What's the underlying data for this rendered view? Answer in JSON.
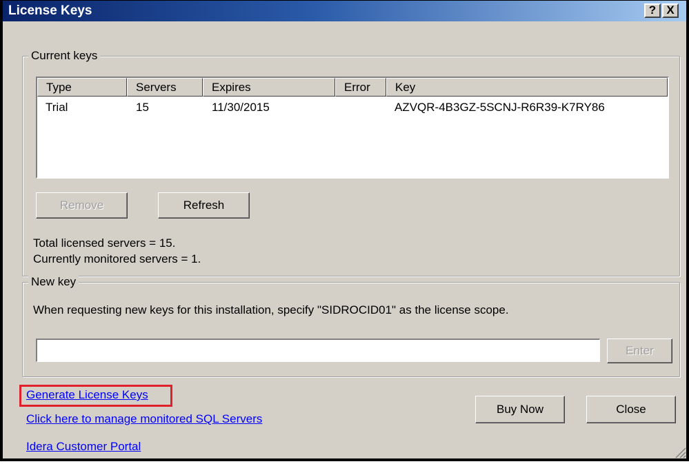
{
  "window": {
    "title": "License Keys",
    "help_label": "?",
    "close_label": "X"
  },
  "current_keys": {
    "legend": "Current keys",
    "columns": [
      "Type",
      "Servers",
      "Expires",
      "Error",
      "Key"
    ],
    "rows": [
      {
        "type": "Trial",
        "servers": "15",
        "expires": "11/30/2015",
        "error": "",
        "key": "AZVQR-4B3GZ-5SCNJ-R6R39-K7RY86"
      }
    ],
    "remove_label": "Remove",
    "refresh_label": "Refresh",
    "total_licensed": "Total licensed servers = 15.",
    "currently_monitored": "Currently monitored servers = 1."
  },
  "new_key": {
    "legend": "New key",
    "instruction": "When requesting new keys for this installation, specify \"SIDROCID01\" as the license scope.",
    "input_value": "",
    "enter_label": "Enter"
  },
  "links": {
    "generate": "Generate License Keys",
    "manage": "Click here to manage monitored SQL Servers",
    "portal": "Idera Customer Portal"
  },
  "buttons": {
    "buy_now": "Buy Now",
    "close": "Close"
  },
  "colors": {
    "highlight": "#e0202a",
    "link": "#0000ff",
    "title_start": "#0a246a"
  }
}
